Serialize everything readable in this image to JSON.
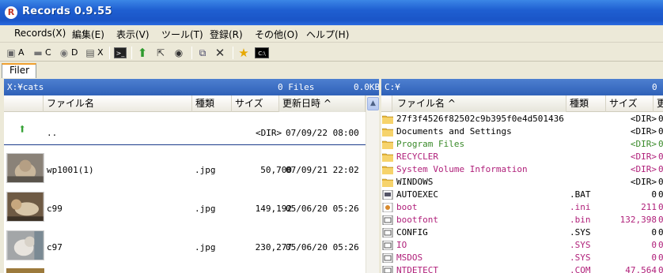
{
  "window": {
    "app_icon_letter": "R",
    "title": "Records 0.9.55"
  },
  "menu": [
    "Records(X)",
    "編集(E)",
    "表示(V)",
    "ツール(T)",
    "登録(R)",
    "その他(O)",
    "ヘルプ(H)"
  ],
  "toolbar": {
    "drive_a": "A",
    "drive_c": "C",
    "drive_d": "D",
    "drive_x": "X",
    "cmd_label": "C:\\"
  },
  "tab": {
    "label": "Filer"
  },
  "left_pane": {
    "path": "X:¥cats",
    "file_count": "0 Files",
    "total_size": "0.0KB",
    "headers": {
      "name": "ファイル名",
      "type": "種類",
      "size": "サイズ",
      "date": "更新日時 ^"
    },
    "parent": {
      "name": "..",
      "size": "<DIR>",
      "date": "07/09/22 08:00"
    },
    "rows": [
      {
        "name": "wp1001(1)",
        "ext": ".jpg",
        "size": "50,700",
        "date": "07/09/21 22:02"
      },
      {
        "name": "c99",
        "ext": ".jpg",
        "size": "149,192",
        "date": "05/06/20 05:26"
      },
      {
        "name": "c97",
        "ext": ".jpg",
        "size": "230,277",
        "date": "05/06/20 05:26"
      }
    ]
  },
  "right_pane": {
    "path": "C:¥",
    "file_count": "0",
    "headers": {
      "name": "ファイル名 ^",
      "type": "種類",
      "size": "サイズ",
      "date": "更"
    },
    "colors": {
      "normal": "#000000",
      "system": "#b0207a",
      "green": "#3a8a2a"
    },
    "rows": [
      {
        "name": "27f3f4526f82502c9b395f0e4d501436",
        "ext": "",
        "size": "<DIR>",
        "date": "0",
        "icon": "folder",
        "color": "#000000"
      },
      {
        "name": "Documents and Settings",
        "ext": "",
        "size": "<DIR>",
        "date": "0",
        "icon": "folder",
        "color": "#000000"
      },
      {
        "name": "Program Files",
        "ext": "",
        "size": "<DIR>",
        "date": "0",
        "icon": "folder",
        "color": "#3a8a2a"
      },
      {
        "name": "RECYCLER",
        "ext": "",
        "size": "<DIR>",
        "date": "0",
        "icon": "folder",
        "color": "#b0207a"
      },
      {
        "name": "System Volume Information",
        "ext": "",
        "size": "<DIR>",
        "date": "0",
        "icon": "folder",
        "color": "#b0207a"
      },
      {
        "name": "WINDOWS",
        "ext": "",
        "size": "<DIR>",
        "date": "0",
        "icon": "folder",
        "color": "#000000"
      },
      {
        "name": "AUTOEXEC",
        "ext": ".BAT",
        "size": "0",
        "date": "0",
        "icon": "batch",
        "color": "#000000"
      },
      {
        "name": "boot",
        "ext": ".ini",
        "size": "211",
        "date": "0",
        "icon": "ini",
        "color": "#b0207a"
      },
      {
        "name": "bootfont",
        "ext": ".bin",
        "size": "132,398",
        "date": "0",
        "icon": "file",
        "color": "#b0207a"
      },
      {
        "name": "CONFIG",
        "ext": ".SYS",
        "size": "0",
        "date": "0",
        "icon": "file",
        "color": "#000000"
      },
      {
        "name": "IO",
        "ext": ".SYS",
        "size": "0",
        "date": "0",
        "icon": "file",
        "color": "#b0207a"
      },
      {
        "name": "MSDOS",
        "ext": ".SYS",
        "size": "0",
        "date": "0",
        "icon": "file",
        "color": "#b0207a"
      },
      {
        "name": "NTDETECT",
        "ext": ".COM",
        "size": "47,564",
        "date": "0",
        "icon": "file",
        "color": "#b0207a"
      }
    ]
  }
}
